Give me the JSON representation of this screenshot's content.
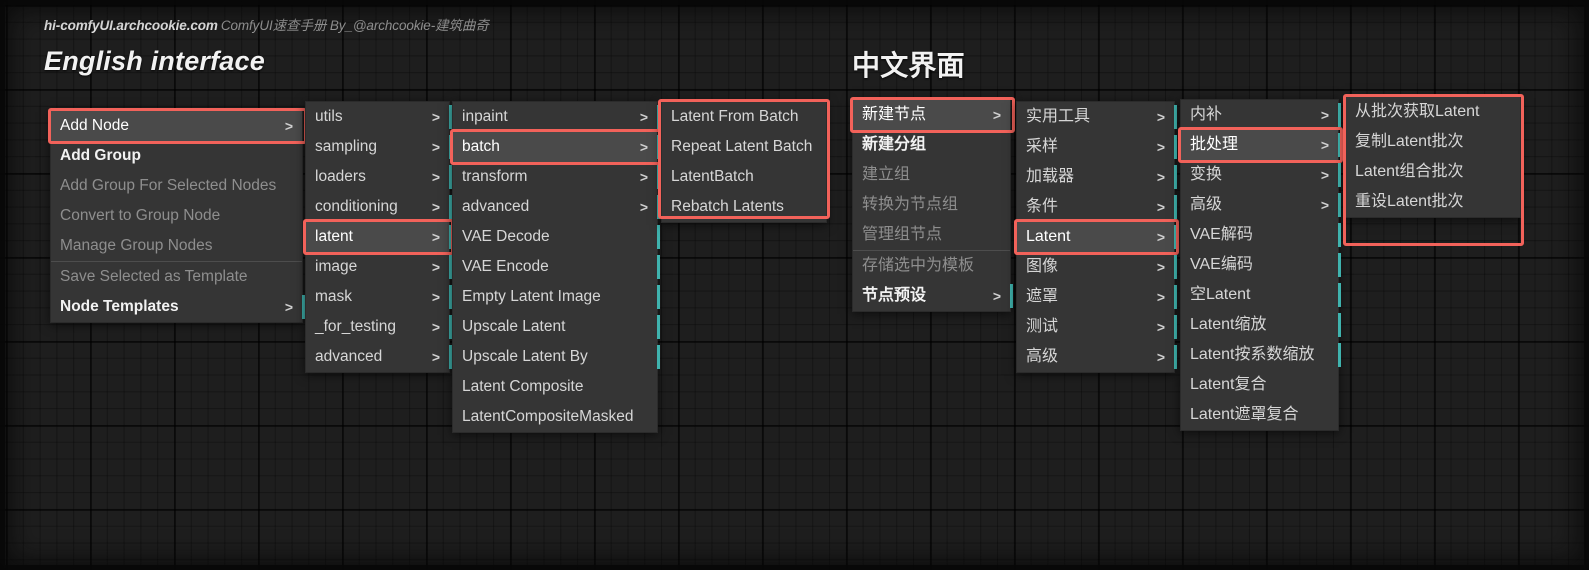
{
  "header": {
    "site": "hi-comfyUI.archcookie.com",
    "subtitle": "ComfyUI速查手册  By_@archcookie-建筑曲奇"
  },
  "titles": {
    "english": "English interface",
    "chinese": "中文界面"
  },
  "colors": {
    "highlight": "#f2625a",
    "accent": "#3fb3ae",
    "menu_bg": "#353535",
    "canvas_bg": "#1e1e1e"
  },
  "arrow_glyph": ">",
  "english": {
    "menu1": {
      "name": "canvas-context-menu",
      "items": [
        {
          "label": "Add Node",
          "arrow": true,
          "state": "highlight"
        },
        {
          "label": "Add Group",
          "arrow": false,
          "state": "bold"
        },
        {
          "label": "Add Group For Selected Nodes",
          "arrow": false,
          "state": "dim"
        },
        {
          "label": "Convert to Group Node",
          "arrow": false,
          "state": "dim"
        },
        {
          "label": "Manage Group Nodes",
          "arrow": false,
          "state": "dim"
        },
        {
          "label": "Save Selected as Template",
          "arrow": false,
          "state": "dim",
          "separator": true
        },
        {
          "label": "Node Templates",
          "arrow": true,
          "state": "bold",
          "accent": true
        }
      ]
    },
    "menu2": {
      "name": "add-node-submenu",
      "items": [
        {
          "label": "utils",
          "arrow": true,
          "accent": true
        },
        {
          "label": "sampling",
          "arrow": true,
          "accent": true
        },
        {
          "label": "loaders",
          "arrow": true,
          "accent": true
        },
        {
          "label": "conditioning",
          "arrow": true,
          "accent": true
        },
        {
          "label": "latent",
          "arrow": true,
          "accent": true,
          "state": "highlight"
        },
        {
          "label": "image",
          "arrow": true,
          "accent": true
        },
        {
          "label": "mask",
          "arrow": true,
          "accent": true
        },
        {
          "label": "_for_testing",
          "arrow": true,
          "accent": true
        },
        {
          "label": "advanced",
          "arrow": true,
          "accent": true
        }
      ]
    },
    "menu3": {
      "name": "latent-submenu",
      "items": [
        {
          "label": "inpaint",
          "arrow": true,
          "accent": true
        },
        {
          "label": "batch",
          "arrow": true,
          "accent": true,
          "state": "highlight"
        },
        {
          "label": "transform",
          "arrow": true,
          "accent": true
        },
        {
          "label": "advanced",
          "arrow": true,
          "accent": true
        },
        {
          "label": "VAE Decode",
          "arrow": false,
          "accent": true
        },
        {
          "label": "VAE Encode",
          "arrow": false,
          "accent": true
        },
        {
          "label": "Empty Latent Image",
          "arrow": false,
          "accent": true
        },
        {
          "label": "Upscale Latent",
          "arrow": false,
          "accent": true
        },
        {
          "label": "Upscale Latent By",
          "arrow": false,
          "accent": true
        },
        {
          "label": "Latent Composite",
          "arrow": false
        },
        {
          "label": "LatentCompositeMasked",
          "arrow": false
        }
      ]
    },
    "menu4": {
      "name": "batch-submenu",
      "items": [
        {
          "label": "Latent From Batch",
          "arrow": false
        },
        {
          "label": "Repeat Latent Batch",
          "arrow": false
        },
        {
          "label": "LatentBatch",
          "arrow": false
        },
        {
          "label": "Rebatch Latents",
          "arrow": false
        }
      ]
    }
  },
  "chinese": {
    "menu1": {
      "name": "canvas-context-menu-cn",
      "items": [
        {
          "label": "新建节点",
          "arrow": true,
          "state": "highlight"
        },
        {
          "label": "新建分组",
          "arrow": false,
          "state": "bold"
        },
        {
          "label": "建立组",
          "arrow": false,
          "state": "dim"
        },
        {
          "label": "转换为节点组",
          "arrow": false,
          "state": "dim"
        },
        {
          "label": "管理组节点",
          "arrow": false,
          "state": "dim"
        },
        {
          "label": "存储选中为模板",
          "arrow": false,
          "state": "dim",
          "separator": true
        },
        {
          "label": "节点预设",
          "arrow": true,
          "state": "bold",
          "accent": true
        }
      ]
    },
    "menu2": {
      "name": "add-node-submenu-cn",
      "items": [
        {
          "label": "实用工具",
          "arrow": true,
          "accent": true
        },
        {
          "label": "采样",
          "arrow": true,
          "accent": true
        },
        {
          "label": "加载器",
          "arrow": true,
          "accent": true
        },
        {
          "label": "条件",
          "arrow": true,
          "accent": true
        },
        {
          "label": "Latent",
          "arrow": true,
          "accent": true,
          "state": "highlight"
        },
        {
          "label": "图像",
          "arrow": true,
          "accent": true
        },
        {
          "label": "遮罩",
          "arrow": true,
          "accent": true
        },
        {
          "label": "测试",
          "arrow": true,
          "accent": true
        },
        {
          "label": "高级",
          "arrow": true,
          "accent": true
        }
      ]
    },
    "menu3": {
      "name": "latent-submenu-cn",
      "items": [
        {
          "label": "内补",
          "arrow": true,
          "accent": true
        },
        {
          "label": "批处理",
          "arrow": true,
          "accent": true,
          "state": "highlight"
        },
        {
          "label": "变换",
          "arrow": true,
          "accent": true
        },
        {
          "label": "高级",
          "arrow": true,
          "accent": true
        },
        {
          "label": "VAE解码",
          "arrow": false,
          "accent": true
        },
        {
          "label": "VAE编码",
          "arrow": false,
          "accent": true
        },
        {
          "label": "空Latent",
          "arrow": false,
          "accent": true
        },
        {
          "label": "Latent缩放",
          "arrow": false,
          "accent": true
        },
        {
          "label": "Latent按系数缩放",
          "arrow": false,
          "accent": true
        },
        {
          "label": "Latent复合",
          "arrow": false
        },
        {
          "label": "Latent遮罩复合",
          "arrow": false
        }
      ]
    },
    "menu4": {
      "name": "batch-submenu-cn",
      "items": [
        {
          "label": "从批次获取Latent",
          "arrow": false
        },
        {
          "label": "复制Latent批次",
          "arrow": false
        },
        {
          "label": "Latent组合批次",
          "arrow": false
        },
        {
          "label": "重设Latent批次",
          "arrow": false
        }
      ]
    }
  }
}
